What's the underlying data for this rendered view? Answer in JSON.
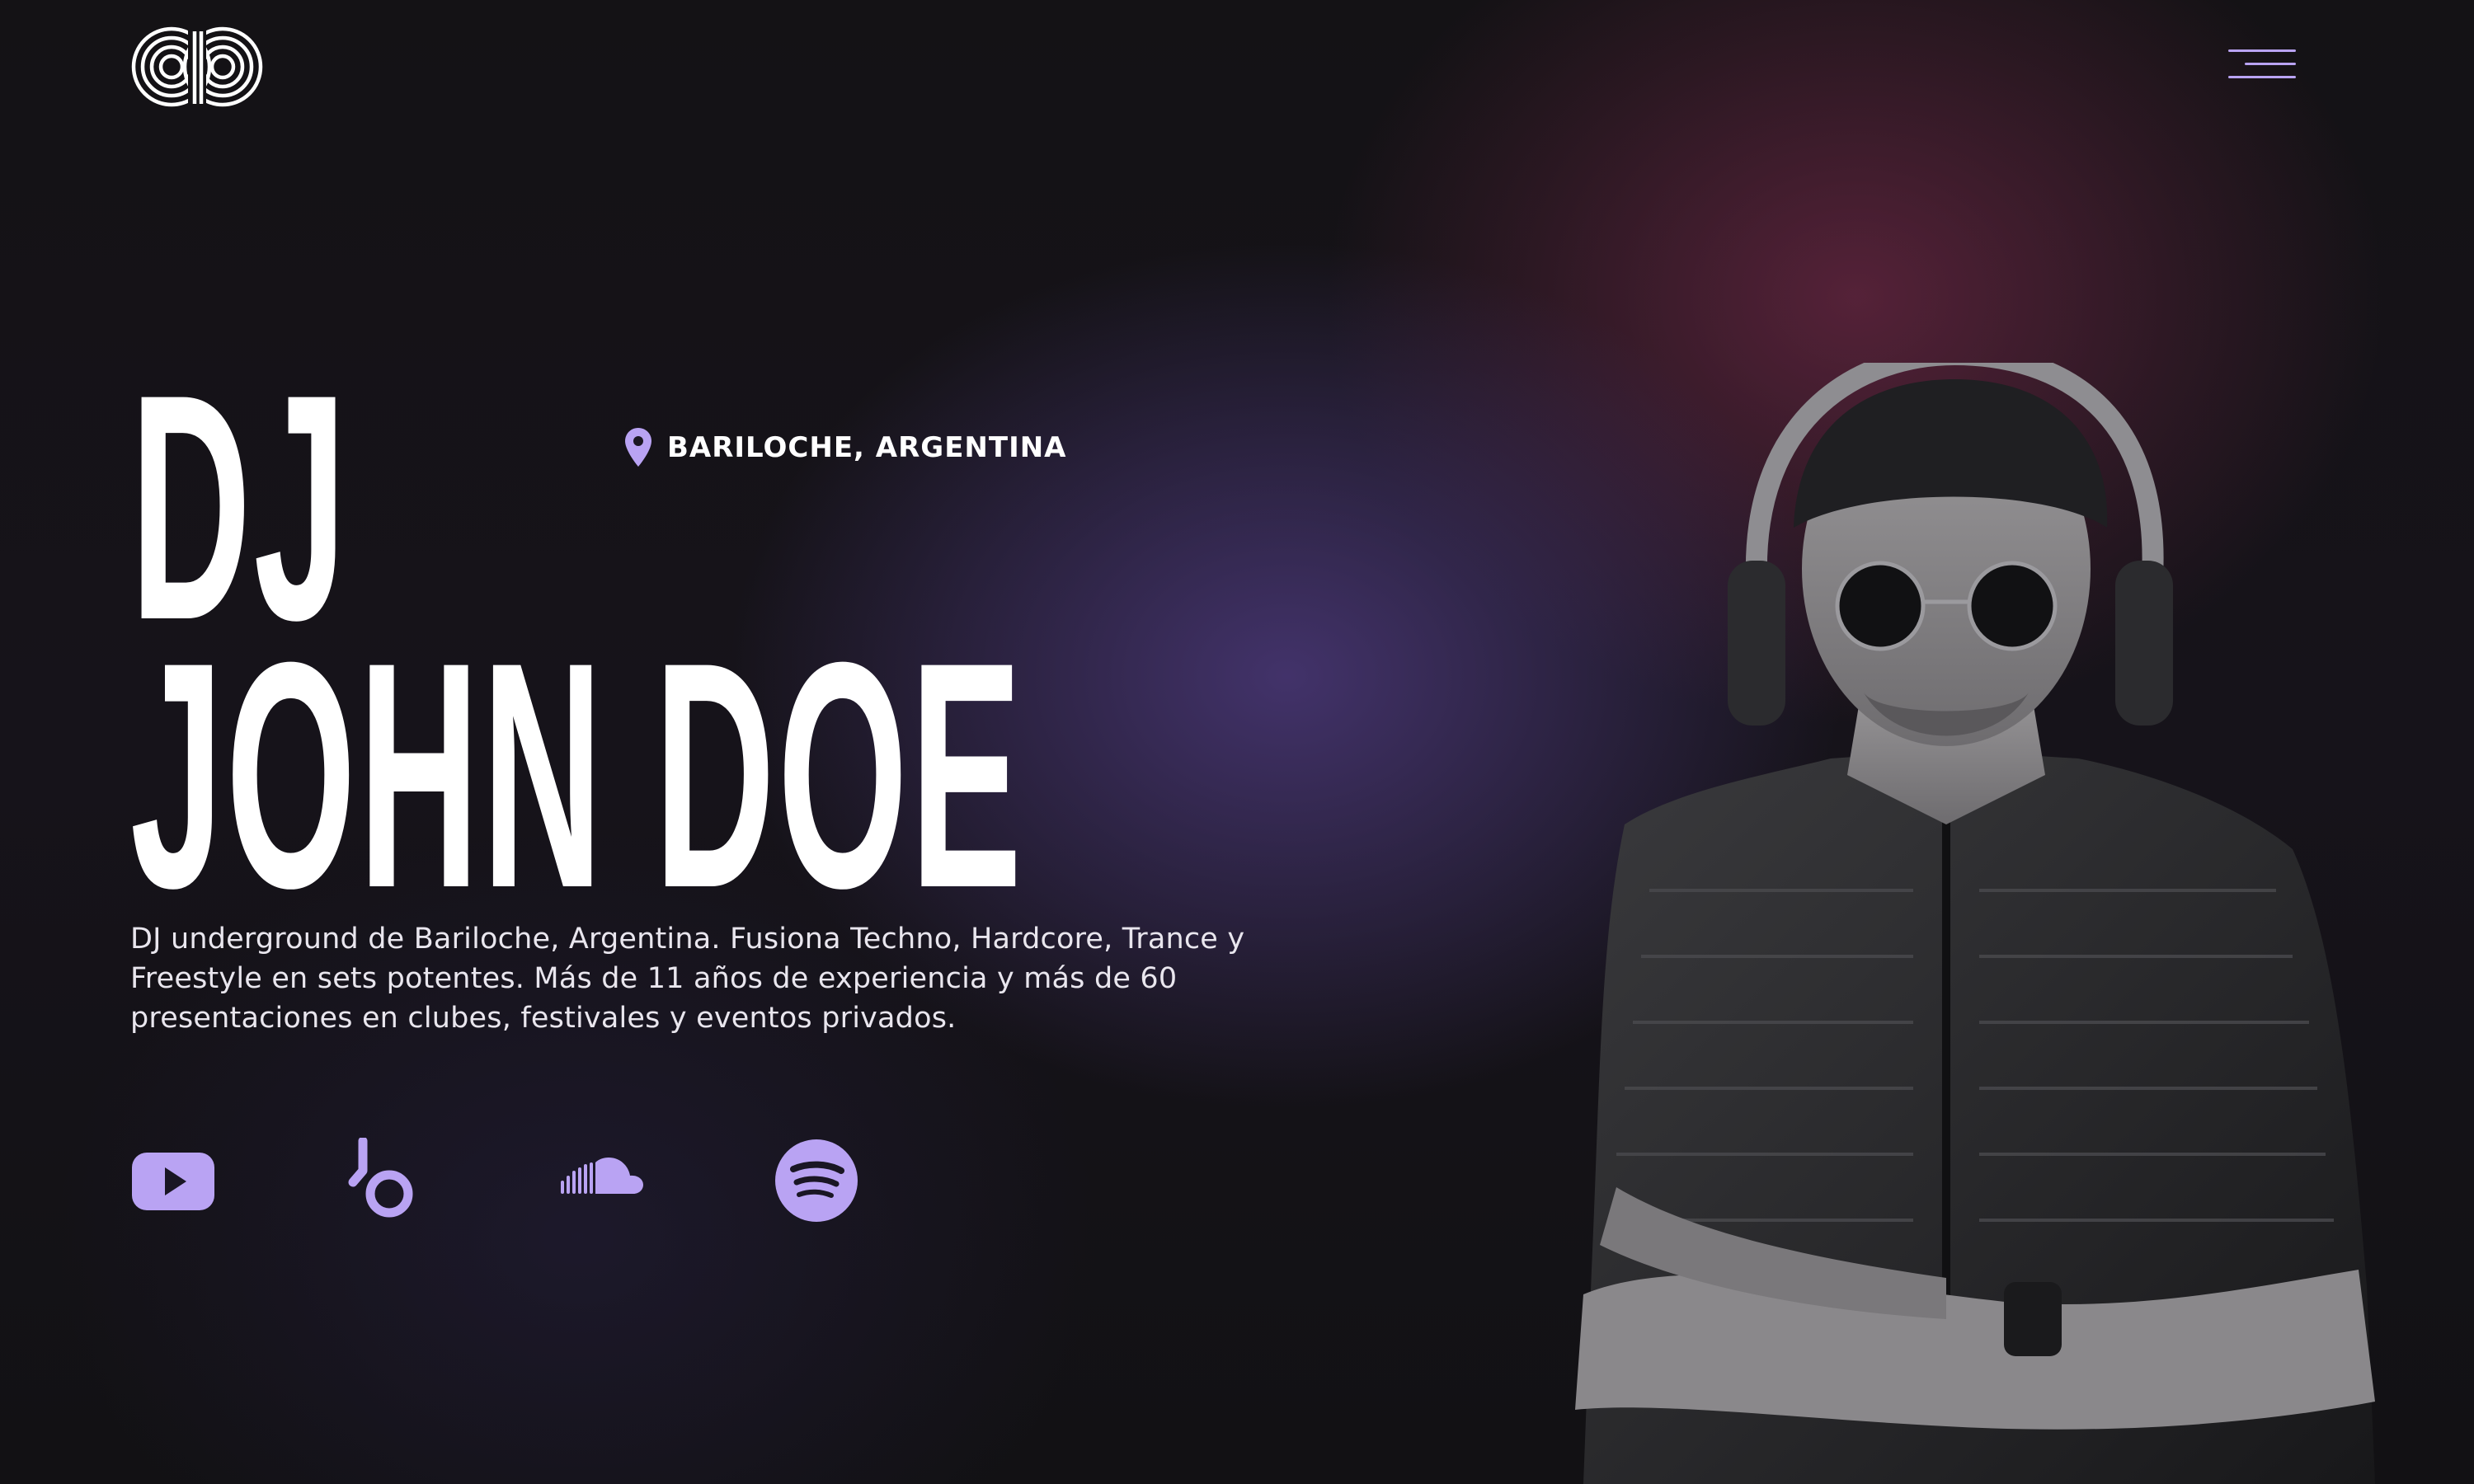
{
  "header": {
    "logo_icon": "pd-monogram-logo-icon",
    "menu_icon": "hamburger-menu-icon"
  },
  "hero": {
    "title_line_1": "DJ",
    "title_line_2": "JOHN DOE",
    "location": {
      "icon": "map-pin-icon",
      "text": "BARILOCHE, ARGENTINA"
    },
    "description": "DJ underground de Bariloche, Argentina. Fusiona Techno, Hardcore, Trance y Freestyle en sets potentes. Más de 11 años de experiencia y más de 60 presentaciones en clubes, festivales y eventos privados."
  },
  "social": [
    {
      "name": "youtube",
      "icon": "youtube-icon"
    },
    {
      "name": "beatport",
      "icon": "beatport-icon"
    },
    {
      "name": "soundcloud",
      "icon": "soundcloud-icon"
    },
    {
      "name": "spotify",
      "icon": "spotify-icon"
    }
  ],
  "colors": {
    "accent": "#b9a3f3",
    "text": "#ffffff",
    "background": "#121114"
  }
}
